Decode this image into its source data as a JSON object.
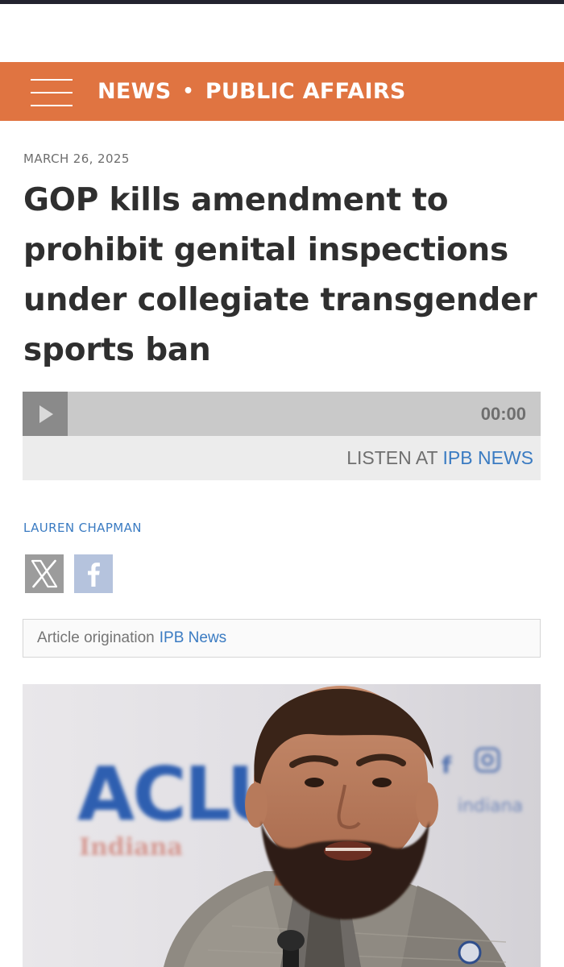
{
  "header": {
    "section": "NEWS",
    "separator": "•",
    "subsection": "PUBLIC AFFAIRS",
    "background_color": "#e07441"
  },
  "article": {
    "date": "MARCH 26, 2025",
    "headline": "GOP kills amendment to prohibit genital inspections under collegiate transgender sports ban",
    "author": "LAUREN CHAPMAN"
  },
  "audio": {
    "time": "00:00",
    "listen_prefix": "LISTEN AT",
    "listen_link": "IPB NEWS"
  },
  "share": {
    "x_icon": "x-logo-icon",
    "facebook_icon": "facebook-icon"
  },
  "origination": {
    "prefix": "Article origination",
    "link": "IPB News"
  },
  "photo": {
    "sign_text": "ACLU",
    "sign_subtext": "Indiana",
    "sign_corner_text": "indiana"
  }
}
